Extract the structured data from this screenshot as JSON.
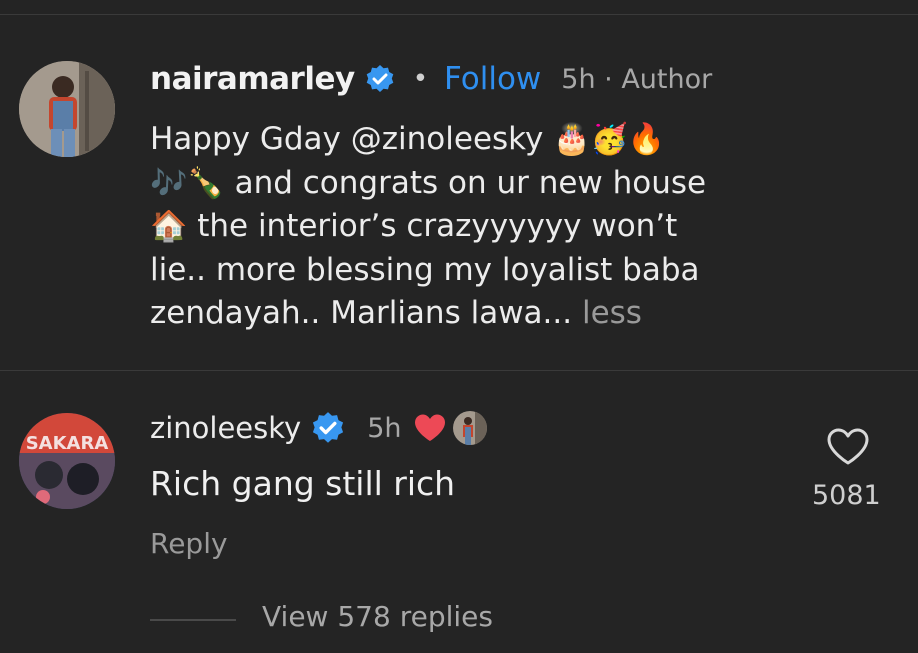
{
  "post": {
    "username": "nairamarley",
    "separator": "•",
    "follow_label": "Follow",
    "meta": "5h · Author",
    "caption": {
      "line1_text": "Happy Gday @zinoleesky ",
      "line1_emoji": "🎂🥳🔥",
      "line2_emoji": "🎶🍾",
      "line2_text": " and congrats on ur new house",
      "line3_emoji": "🏠",
      "line3_text": " the interior’s crazyyyyyy won’t",
      "line4_text": "lie.. more blessing my loyalist baba",
      "line5_text": "zendayah.. Marlians lawa...",
      "less_label": " less"
    }
  },
  "reply": {
    "username": "zinoleesky",
    "time": "5h",
    "avatar_text": "SAKARA",
    "text": "Rich gang still rich",
    "reply_label": "Reply",
    "like_count": "5081",
    "view_replies_label": "View 578 replies"
  },
  "colors": {
    "background": "#242424",
    "follow_blue": "#2f8ff0",
    "verified_blue": "#3897f0",
    "heart_red": "#ed4956"
  },
  "icons": {
    "verified": "verified-badge-icon",
    "heart": "heart-icon",
    "like": "heart-outline-icon"
  }
}
